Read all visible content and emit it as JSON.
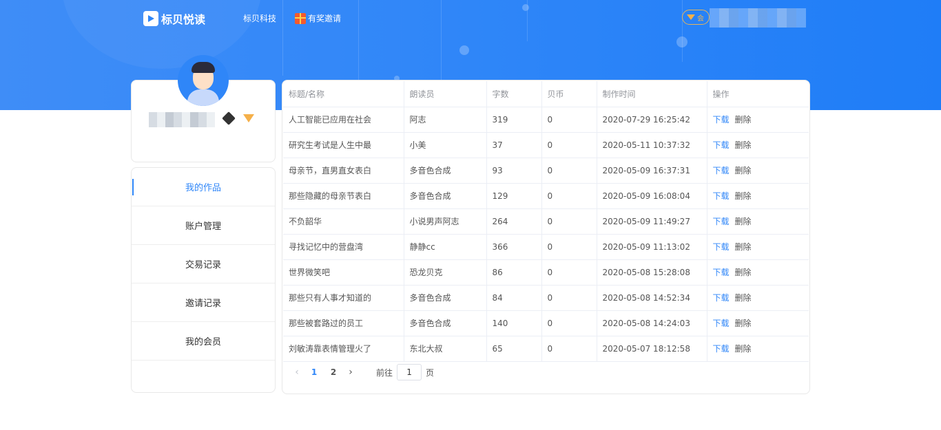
{
  "nav": {
    "brand": "标贝悦读",
    "links": [
      "标贝科技",
      "有奖邀请"
    ],
    "vip_chip": "会"
  },
  "colors": {
    "accent": "#2f86f8",
    "vip_gold": "#f5b04a"
  },
  "menu": [
    {
      "label": "我的作品",
      "active": true
    },
    {
      "label": "账户管理",
      "active": false
    },
    {
      "label": "交易记录",
      "active": false
    },
    {
      "label": "邀请记录",
      "active": false
    },
    {
      "label": "我的会员",
      "active": false
    }
  ],
  "table": {
    "headers": [
      "标题/名称",
      "朗读员",
      "字数",
      "贝币",
      "制作时间",
      "操作"
    ],
    "action_download": "下载",
    "action_delete": "删除",
    "rows": [
      [
        "人工智能已应用在社会",
        "阿志",
        "319",
        "0",
        "2020-07-29 16:25:42"
      ],
      [
        "研究生考试是人生中最",
        "小美",
        "37",
        "0",
        "2020-05-11 10:37:32"
      ],
      [
        "母亲节，直男直女表白",
        "多音色合成",
        "93",
        "0",
        "2020-05-09 16:37:31"
      ],
      [
        "那些隐藏的母亲节表白",
        "多音色合成",
        "129",
        "0",
        "2020-05-09 16:08:04"
      ],
      [
        "不负韶华",
        "小说男声阿志",
        "264",
        "0",
        "2020-05-09 11:49:27"
      ],
      [
        "寻找记忆中的营盘湾",
        "静静cc",
        "366",
        "0",
        "2020-05-09 11:13:02"
      ],
      [
        "世界微笑吧",
        "恐龙贝克",
        "86",
        "0",
        "2020-05-08 15:28:08"
      ],
      [
        "那些只有人事才知道的",
        "多音色合成",
        "84",
        "0",
        "2020-05-08 14:52:34"
      ],
      [
        "那些被套路过的员工",
        "多音色合成",
        "140",
        "0",
        "2020-05-08 14:24:03"
      ],
      [
        "刘敏涛靠表情管理火了",
        "东北大叔",
        "65",
        "0",
        "2020-05-07 18:12:58"
      ]
    ]
  },
  "pager": {
    "pages": [
      "1",
      "2"
    ],
    "current": "1",
    "goto_prefix": "前往",
    "goto_value": "1",
    "goto_suffix": "页"
  }
}
